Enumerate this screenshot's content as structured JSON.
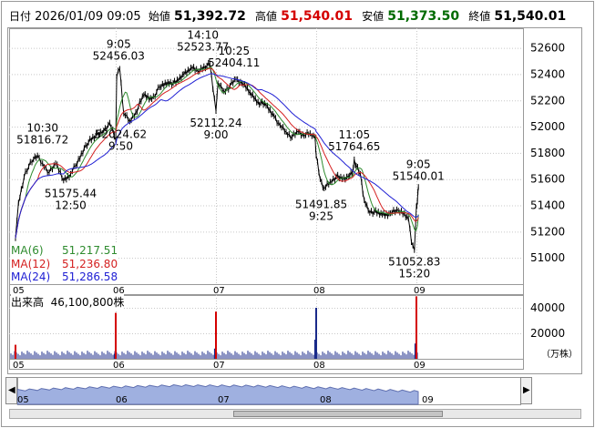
{
  "header": {
    "date_label": "日付",
    "datetime": "2026/01/09 09:05",
    "open_label": "始値",
    "open": "51,392.72",
    "high_label": "高値",
    "high": "51,540.01",
    "low_label": "安値",
    "low": "51,373.50",
    "close_label": "終値",
    "close": "51,540.01"
  },
  "ma_legend": [
    {
      "label": "MA(6)",
      "value": "51,217.51",
      "color": "#2e8b2e"
    },
    {
      "label": "MA(12)",
      "value": "51,236.80",
      "color": "#d42020"
    },
    {
      "label": "MA(24)",
      "value": "51,286.58",
      "color": "#2020d4"
    }
  ],
  "volume": {
    "label": "出来高",
    "value": "46,100,800株",
    "unit": "（万株）",
    "yticks": [
      20000,
      40000
    ],
    "ylim": [
      0,
      50000
    ]
  },
  "colors": {
    "candle_up": "#000000",
    "candle_down": "#000000",
    "ma6": "#2e8b2e",
    "ma12": "#d42020",
    "ma24": "#2020d4",
    "vol_normal": "#1a2a8a",
    "vol_open": "#d40000",
    "overview_fill": "#9fb0e0",
    "grid": "#c8c8c8"
  },
  "chart_data": {
    "type": "line",
    "title": "",
    "xlabel": "",
    "ylabel": "",
    "days": [
      "05",
      "06",
      "07",
      "08",
      "09"
    ],
    "ylim": [
      50800,
      52750
    ],
    "yticks": [
      51000,
      51200,
      51400,
      51600,
      51800,
      52000,
      52200,
      52400,
      52600
    ],
    "grid": true,
    "price_points": [
      {
        "d": 0.0,
        "v": 51150
      },
      {
        "d": 0.03,
        "v": 51420
      },
      {
        "d": 0.1,
        "v": 51660
      },
      {
        "d": 0.18,
        "v": 51750
      },
      {
        "d": 0.22,
        "v": 51780
      },
      {
        "d": 0.27,
        "v": 51720
      },
      {
        "d": 0.32,
        "v": 51650
      },
      {
        "d": 0.4,
        "v": 51720
      },
      {
        "d": 0.48,
        "v": 51590
      },
      {
        "d": 0.55,
        "v": 51640
      },
      {
        "d": 0.6,
        "v": 51700
      },
      {
        "d": 0.7,
        "v": 51860
      },
      {
        "d": 0.8,
        "v": 51930
      },
      {
        "d": 0.88,
        "v": 51970
      },
      {
        "d": 0.94,
        "v": 52030
      },
      {
        "d": 1.0,
        "v": 51900
      },
      {
        "d": 1.01,
        "v": 52380
      },
      {
        "d": 1.04,
        "v": 52440
      },
      {
        "d": 1.08,
        "v": 52100
      },
      {
        "d": 1.14,
        "v": 52040
      },
      {
        "d": 1.2,
        "v": 52110
      },
      {
        "d": 1.28,
        "v": 52240
      },
      {
        "d": 1.36,
        "v": 52210
      },
      {
        "d": 1.44,
        "v": 52300
      },
      {
        "d": 1.52,
        "v": 52340
      },
      {
        "d": 1.6,
        "v": 52330
      },
      {
        "d": 1.68,
        "v": 52400
      },
      {
        "d": 1.75,
        "v": 52450
      },
      {
        "d": 1.82,
        "v": 52420
      },
      {
        "d": 1.88,
        "v": 52460
      },
      {
        "d": 1.94,
        "v": 52470
      },
      {
        "d": 2.0,
        "v": 52120
      },
      {
        "d": 2.02,
        "v": 52330
      },
      {
        "d": 2.08,
        "v": 52270
      },
      {
        "d": 2.14,
        "v": 52310
      },
      {
        "d": 2.2,
        "v": 52360
      },
      {
        "d": 2.26,
        "v": 52330
      },
      {
        "d": 2.34,
        "v": 52260
      },
      {
        "d": 2.42,
        "v": 52190
      },
      {
        "d": 2.5,
        "v": 52160
      },
      {
        "d": 2.58,
        "v": 52080
      },
      {
        "d": 2.64,
        "v": 52010
      },
      {
        "d": 2.7,
        "v": 51960
      },
      {
        "d": 2.76,
        "v": 51920
      },
      {
        "d": 2.82,
        "v": 51960
      },
      {
        "d": 2.88,
        "v": 51930
      },
      {
        "d": 2.94,
        "v": 51950
      },
      {
        "d": 2.99,
        "v": 51910
      },
      {
        "d": 3.0,
        "v": 51780
      },
      {
        "d": 3.04,
        "v": 51600
      },
      {
        "d": 3.08,
        "v": 51530
      },
      {
        "d": 3.14,
        "v": 51580
      },
      {
        "d": 3.2,
        "v": 51620
      },
      {
        "d": 3.26,
        "v": 51600
      },
      {
        "d": 3.32,
        "v": 51620
      },
      {
        "d": 3.36,
        "v": 51640
      },
      {
        "d": 3.38,
        "v": 51750
      },
      {
        "d": 3.4,
        "v": 51700
      },
      {
        "d": 3.44,
        "v": 51640
      },
      {
        "d": 3.48,
        "v": 51440
      },
      {
        "d": 3.52,
        "v": 51360
      },
      {
        "d": 3.58,
        "v": 51350
      },
      {
        "d": 3.66,
        "v": 51330
      },
      {
        "d": 3.74,
        "v": 51340
      },
      {
        "d": 3.82,
        "v": 51360
      },
      {
        "d": 3.88,
        "v": 51340
      },
      {
        "d": 3.92,
        "v": 51300
      },
      {
        "d": 3.95,
        "v": 51120
      },
      {
        "d": 3.98,
        "v": 51060
      },
      {
        "d": 4.0,
        "v": 51392.72
      },
      {
        "d": 4.01,
        "v": 51430
      },
      {
        "d": 4.02,
        "v": 51540.01
      }
    ],
    "annotations": [
      {
        "time": "10:30",
        "value": "51816.72",
        "d": 0.27,
        "v": 51816.72,
        "pos": "above"
      },
      {
        "time": "12:50",
        "value": "51575.44",
        "d": 0.55,
        "v": 51575.44,
        "pos": "below"
      },
      {
        "time": "9:05",
        "value": "52456.03",
        "d": 1.03,
        "v": 52456.03,
        "pos": "above"
      },
      {
        "time": "9:50",
        "value": "52024.62",
        "d": 1.05,
        "v": 52024.62,
        "pos": "below"
      },
      {
        "time": "14:10",
        "value": "52523.77",
        "d": 1.87,
        "v": 52523.77,
        "pos": "above"
      },
      {
        "time": "10:25",
        "value": "52404.11",
        "d": 2.18,
        "v": 52404.11,
        "pos": "above"
      },
      {
        "time": "9:00",
        "value": "52112.24",
        "d": 2.0,
        "v": 52112.24,
        "pos": "below"
      },
      {
        "time": "11:05",
        "value": "51764.65",
        "d": 3.38,
        "v": 51764.65,
        "pos": "above"
      },
      {
        "time": "9:25",
        "value": "51491.85",
        "d": 3.05,
        "v": 51491.85,
        "pos": "below"
      },
      {
        "time": "9:05",
        "value": "51540.01",
        "d": 4.02,
        "v": 51540.01,
        "pos": "above"
      },
      {
        "time": "15:20",
        "value": "51052.83",
        "d": 3.98,
        "v": 51052.83,
        "pos": "below"
      }
    ],
    "volume_spikes": [
      {
        "d": 0.0,
        "v": 11000,
        "color": "vol_open"
      },
      {
        "d": 0.99,
        "v": 4000,
        "color": "vol_normal"
      },
      {
        "d": 1.0,
        "v": 36000,
        "color": "vol_open"
      },
      {
        "d": 1.99,
        "v": 8000,
        "color": "vol_normal"
      },
      {
        "d": 2.0,
        "v": 37000,
        "color": "vol_open"
      },
      {
        "d": 2.99,
        "v": 15000,
        "color": "vol_normal"
      },
      {
        "d": 3.0,
        "v": 40000,
        "color": "vol_normal"
      },
      {
        "d": 3.99,
        "v": 12000,
        "color": "vol_normal"
      },
      {
        "d": 4.0,
        "v": 49000,
        "color": "vol_open"
      }
    ],
    "volume_base": 5000,
    "overview_levels": [
      0.55,
      0.65,
      0.72,
      0.7,
      0.62,
      0.5
    ]
  }
}
